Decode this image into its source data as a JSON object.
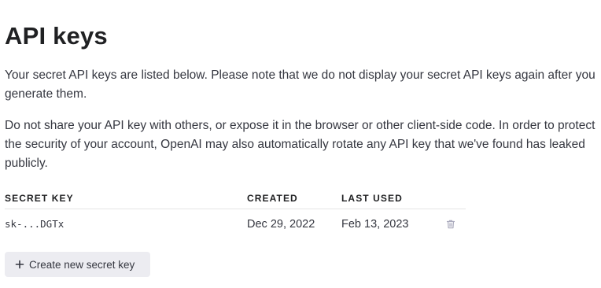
{
  "page": {
    "title": "API keys",
    "intro": "Your secret API keys are listed below. Please note that we do not display your secret API keys again after you generate them.",
    "warning": "Do not share your API key with others, or expose it in the browser or other client-side code. In order to protect the security of your account, OpenAI may also automatically rotate any API key that we've found has leaked publicly."
  },
  "table": {
    "headers": {
      "secret_key": "SECRET KEY",
      "created": "CREATED",
      "last_used": "LAST USED"
    },
    "rows": [
      {
        "secret_key": "sk-...DGTx",
        "created": "Dec 29, 2022",
        "last_used": "Feb 13, 2023",
        "delete_icon": "trash-icon"
      }
    ]
  },
  "actions": {
    "create_label": "Create new secret key",
    "create_icon": "plus-icon"
  },
  "colors": {
    "text": "#353740",
    "heading": "#202123",
    "button_bg": "#ececf1",
    "border": "#e5e5e5",
    "icon_muted": "#acacbe"
  }
}
